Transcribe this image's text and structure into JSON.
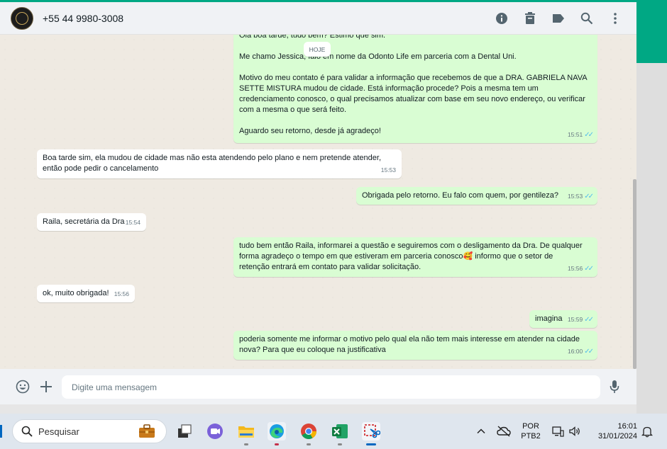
{
  "header": {
    "contact_name": "+55 44 9980-3008",
    "icons": [
      "info-icon",
      "delete-icon",
      "label-icon",
      "search-icon",
      "menu-icon"
    ]
  },
  "chat": {
    "date_chip": "HOJE",
    "messages": [
      {
        "direction": "out",
        "lines": [
          "Ola boa tarde, tudo bem? Estimo que sim.",
          "",
          "Me chamo Jessica, falo em nome da Odonto Life em parceria com a Dental Uni.",
          "",
          "Motivo do meu contato é para validar a informação que recebemos de que a DRA. GABRIELA NAVA",
          "SETTE MISTURA mudou de cidade. Está informação procede? Pois a mesma tem um",
          "credenciamento conosco, o qual precisamos atualizar com base em seu novo endereço, ou verificar",
          "com a mesma o que será feito.",
          "",
          "Aguardo seu retorno, desde já agradeço!"
        ],
        "time": "15:51"
      },
      {
        "direction": "in",
        "lines": [
          "Boa tarde sim, ela mudou de cidade mas não esta atendendo pelo plano e nem pretende atender,",
          "então pode pedir o cancelamento"
        ],
        "time": "15:53"
      },
      {
        "direction": "out",
        "lines": [
          "Obrigada pelo retorno. Eu falo com quem, por gentileza?"
        ],
        "time": "15:53"
      },
      {
        "direction": "in",
        "lines": [
          "Raila, secretária da Dra"
        ],
        "time": "15:54"
      },
      {
        "direction": "out",
        "lines": [
          "tudo bem então Raila, informarei a questão e seguiremos com o desligamento da Dra. De qualquer",
          "forma agradeço o tempo em que estiveram em parceria conosco🥰 informo que o setor de",
          "retenção entrará em contato para validar solicitação."
        ],
        "time": "15:56"
      },
      {
        "direction": "in",
        "lines": [
          "ok, muito obrigada!"
        ],
        "time": "15:56"
      },
      {
        "direction": "out",
        "lines": [
          "imagina"
        ],
        "time": "15:59"
      },
      {
        "direction": "out",
        "lines": [
          "poderia somente me informar o motivo pelo qual ela não tem mais interesse em atender na cidade",
          "nova? Para que eu coloque na justificativa"
        ],
        "time": "16:00"
      }
    ]
  },
  "composer": {
    "placeholder": "Digite uma mensagem",
    "icons": [
      "emoji-icon",
      "attach-plus-icon",
      "microphone-icon"
    ]
  },
  "taskbar": {
    "search_placeholder": "Pesquisar",
    "apps": [
      "task-view",
      "teams",
      "file-explorer",
      "edge",
      "chrome",
      "excel",
      "snipping-tool"
    ],
    "language": "POR",
    "keyboard": "PTB2",
    "time": "16:01",
    "date": "31/01/2024"
  },
  "colors": {
    "accent": "#00a884",
    "outgoing_bubble": "#d9fdd3",
    "incoming_bubble": "#ffffff",
    "read_ticks": "#53bdeb"
  }
}
